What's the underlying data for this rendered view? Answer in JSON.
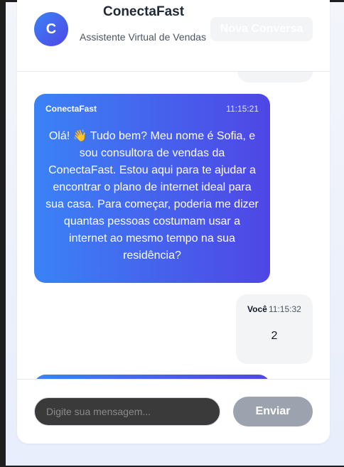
{
  "header": {
    "avatar_letter": "C",
    "title": "ConectaFast",
    "subtitle": "Assistente Virtual de Vendas",
    "new_chat_label": "Nova Conversa"
  },
  "messages": [
    {
      "sender": "ConectaFast",
      "time": "11:15:21",
      "text": "Olá! 👋 Tudo bem? Meu nome é Sofia, e sou consultora de vendas da ConectaFast. Estou aqui para te ajudar a encontrar o plano de internet ideal para sua casa. Para começar, poderia me dizer quantas pessoas costumam usar a internet ao mesmo tempo na sua residência?"
    },
    {
      "sender": "Você",
      "time": "11:15:32",
      "text": "2"
    }
  ],
  "composer": {
    "placeholder": "Digite sua mensagem...",
    "send_label": "Enviar"
  },
  "colors": {
    "accent_start": "#3b82f6",
    "accent_end": "#4f46e5",
    "send_button": "#9ca3af"
  }
}
